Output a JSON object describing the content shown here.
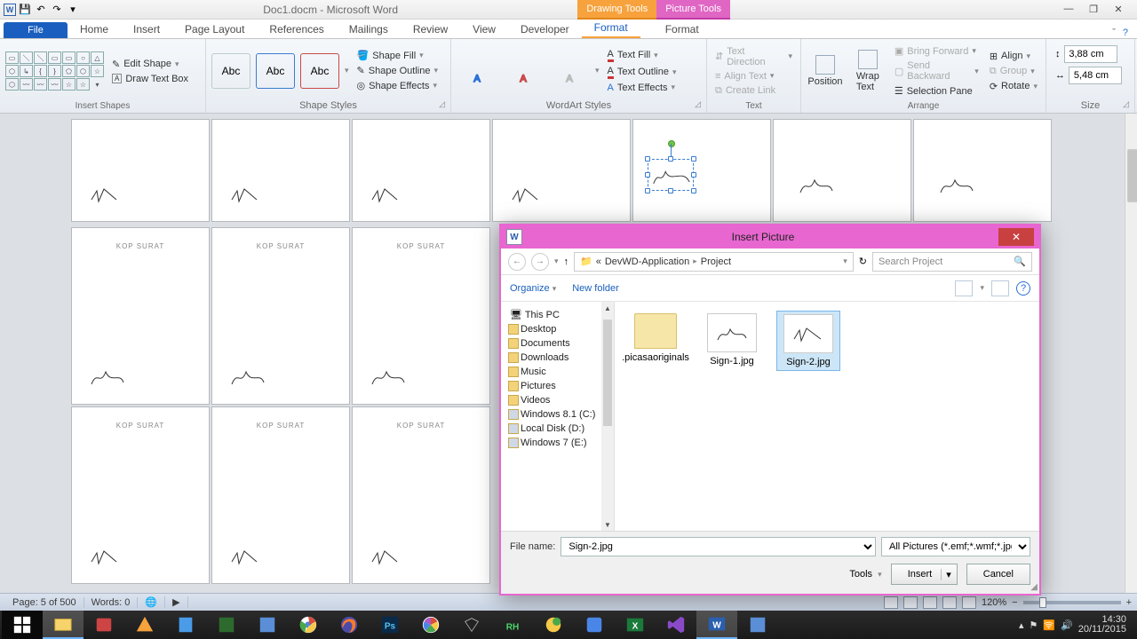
{
  "titlebar": {
    "title": "Doc1.docm - Microsoft Word"
  },
  "context_tabs": {
    "drawing": "Drawing Tools",
    "picture": "Picture Tools"
  },
  "tabs": {
    "file": "File",
    "home": "Home",
    "insert": "Insert",
    "page_layout": "Page Layout",
    "references": "References",
    "mailings": "Mailings",
    "review": "Review",
    "view": "View",
    "developer": "Developer",
    "format1": "Format",
    "format2": "Format"
  },
  "ribbon": {
    "insert_shapes": {
      "label": "Insert Shapes",
      "edit_shape": "Edit Shape",
      "text_box": "Draw Text Box"
    },
    "shape_styles": {
      "label": "Shape Styles",
      "abc": "Abc",
      "fill": "Shape Fill",
      "outline": "Shape Outline",
      "effects": "Shape Effects"
    },
    "wordart": {
      "label": "WordArt Styles",
      "text_fill": "Text Fill",
      "text_outline": "Text Outline",
      "text_effects": "Text Effects"
    },
    "text": {
      "label": "Text",
      "direction": "Text Direction",
      "align": "Align Text",
      "link": "Create Link"
    },
    "arrange": {
      "label": "Arrange",
      "position": "Position",
      "wrap": "Wrap\nText",
      "forward": "Bring Forward",
      "backward": "Send Backward",
      "selection": "Selection Pane",
      "align_btn": "Align",
      "group": "Group",
      "rotate": "Rotate"
    },
    "size": {
      "label": "Size",
      "h": "3,88 cm",
      "w": "5,48 cm"
    }
  },
  "doc": {
    "kop": "KOP SURAT"
  },
  "dialog": {
    "title": "Insert Picture",
    "crumb_prefix": "«",
    "crumb1": "DevWD-Application",
    "crumb2": "Project",
    "search_placeholder": "Search Project",
    "organize": "Organize",
    "new_folder": "New folder",
    "tree": {
      "root": "This PC",
      "items": [
        "Desktop",
        "Documents",
        "Downloads",
        "Music",
        "Pictures",
        "Videos",
        "Windows 8.1 (C:)",
        "Local Disk (D:)",
        "Windows 7 (E:)"
      ]
    },
    "files": {
      "folder": ".picasaoriginals",
      "img1": "Sign-1.jpg",
      "img2": "Sign-2.jpg"
    },
    "filename_label": "File name:",
    "filename_value": "Sign-2.jpg",
    "filter": "All Pictures (*.emf;*.wmf;*.jpg;*",
    "tools": "Tools",
    "insert": "Insert",
    "cancel": "Cancel"
  },
  "status": {
    "page": "Page: 5 of 500",
    "words": "Words: 0",
    "zoom": "120%"
  },
  "clock": {
    "time": "14:30",
    "date": "20/11/2015"
  }
}
